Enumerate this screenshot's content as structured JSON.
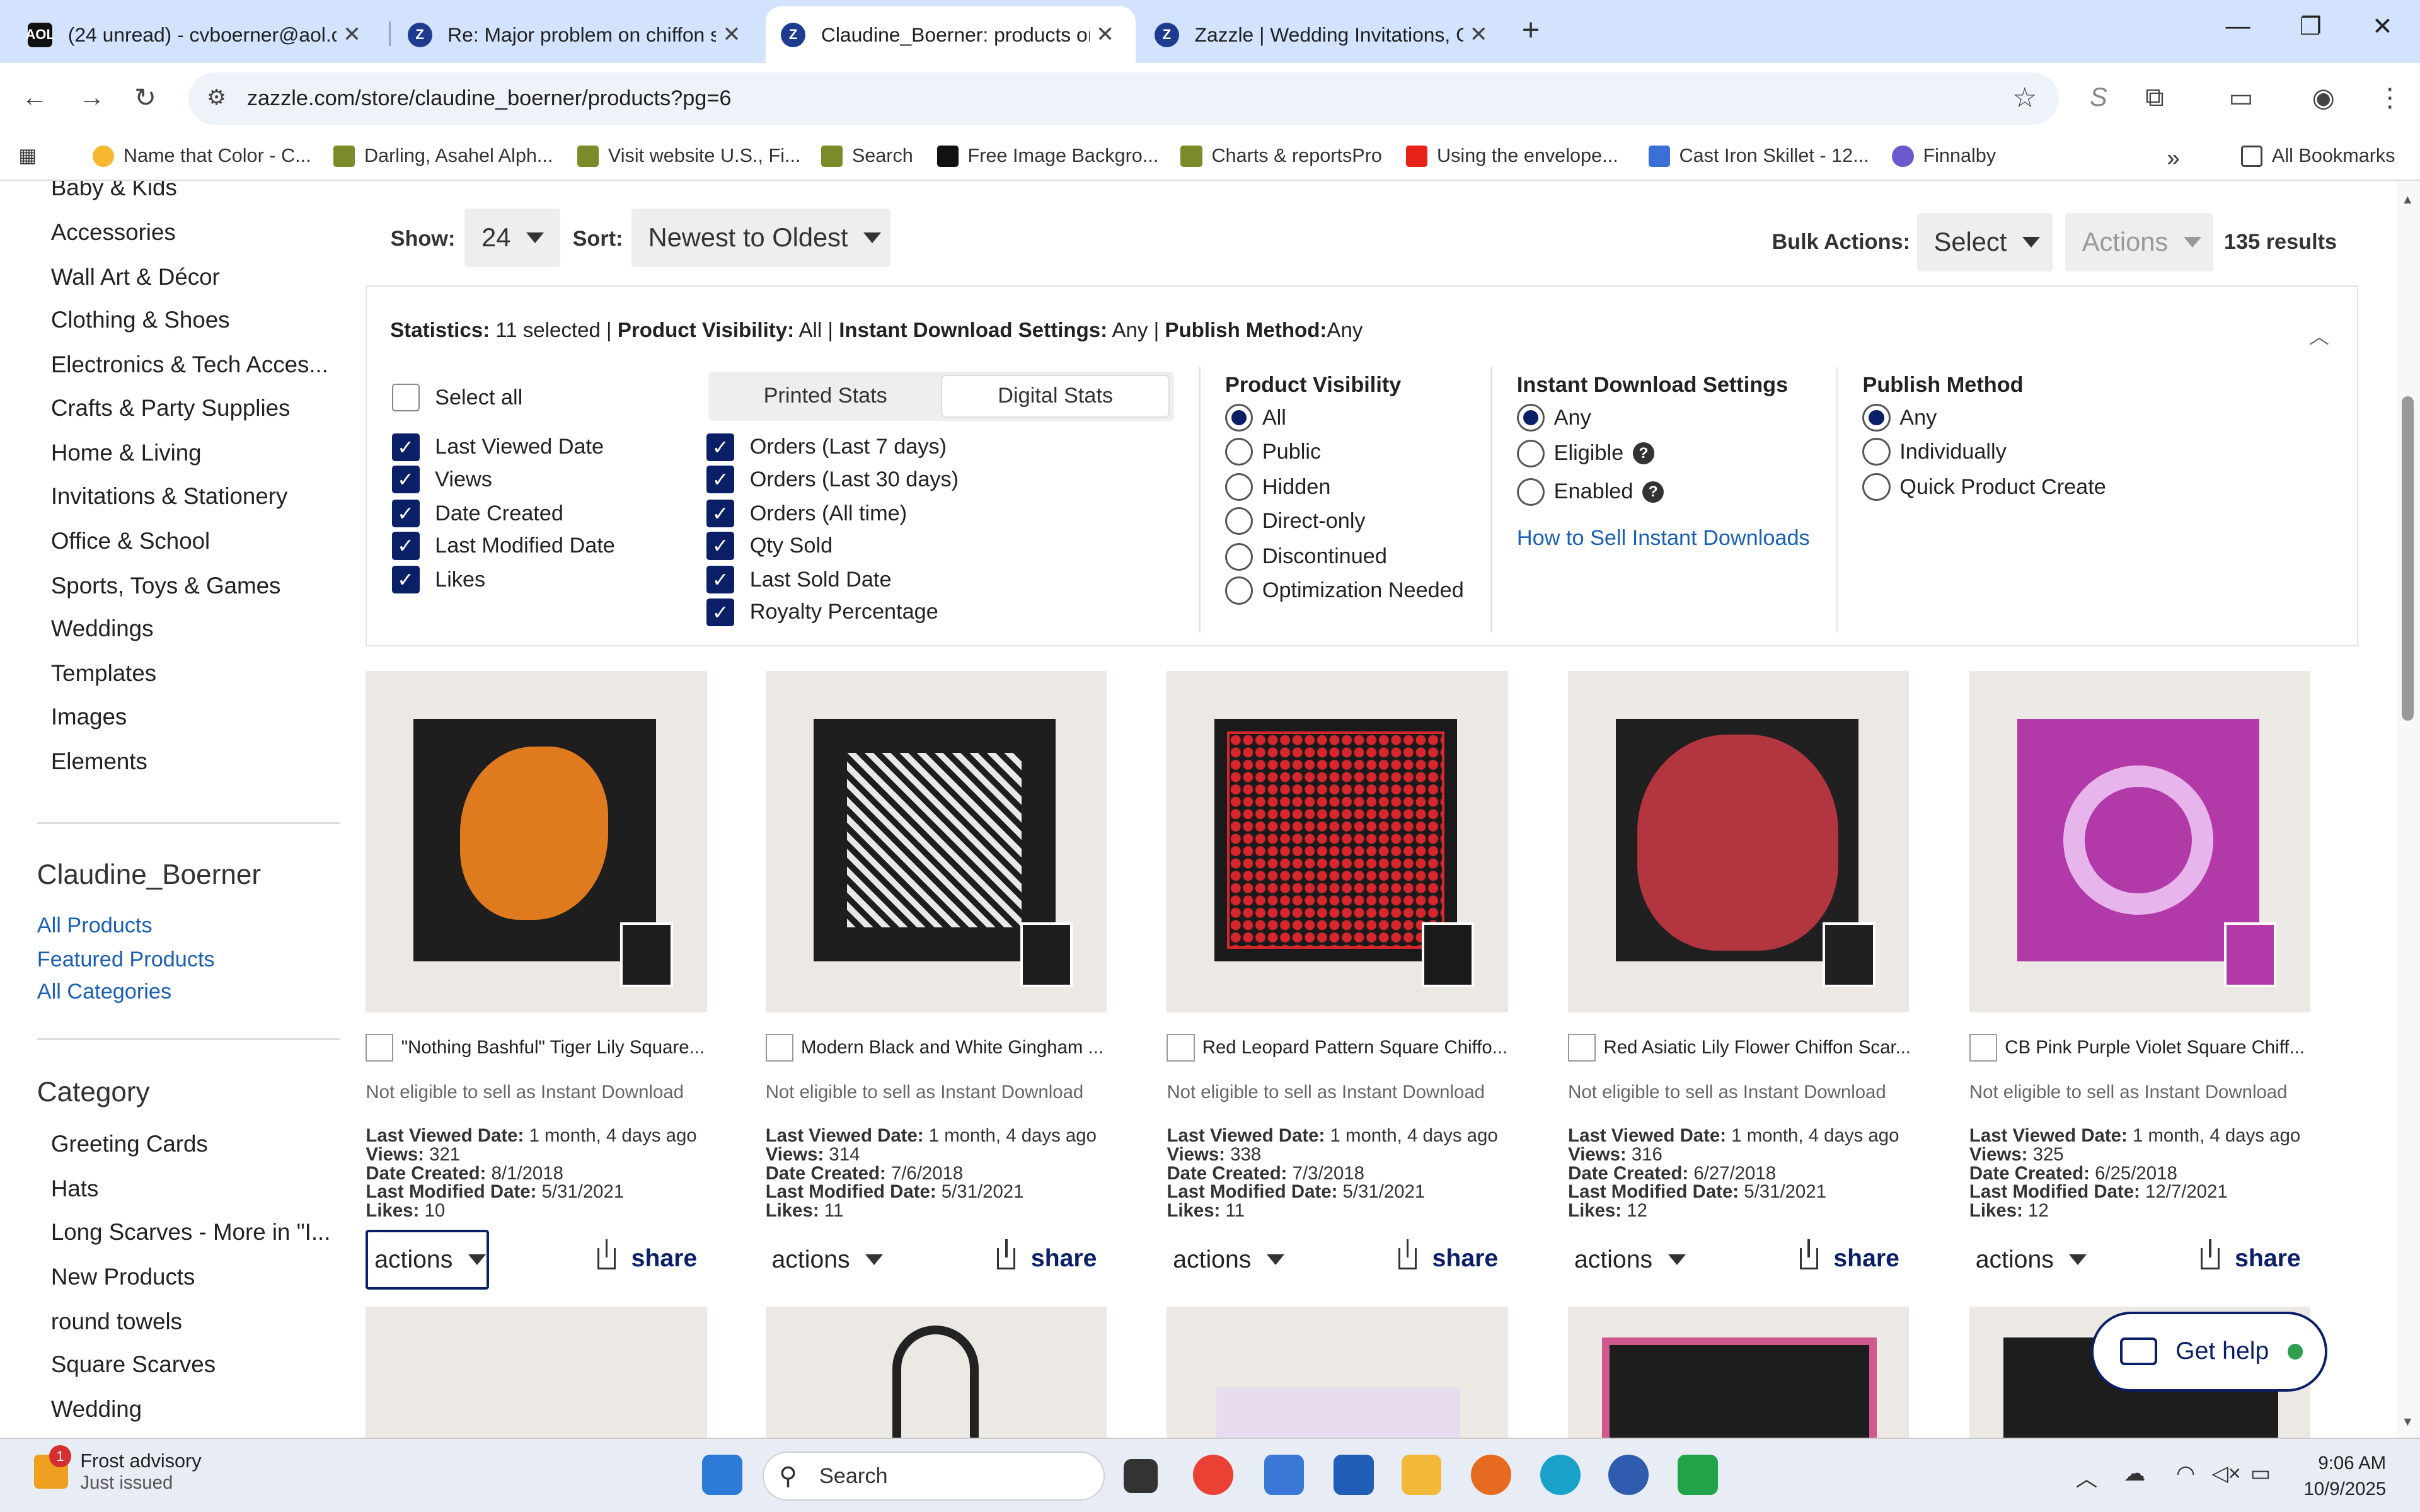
{
  "browser": {
    "tabs": [
      {
        "title": "(24 unread) - cvboerner@aol.co",
        "favicon_text": "AOL"
      },
      {
        "title": "Re: Major problem on chiffon sc",
        "favicon_text": "Z"
      },
      {
        "title": "Claudine_Boerner: products on",
        "favicon_text": "Z"
      },
      {
        "title": "Zazzle | Wedding Invitations, Ch",
        "favicon_text": "Z"
      }
    ],
    "url": "zazzle.com/store/claudine_boerner/products?pg=6",
    "bookmarks": [
      "Name that Color - C...",
      "Darling, Asahel Alph...",
      "Visit website U.S., Fi...",
      "Search",
      "Free Image Backgro...",
      "Charts & reportsPro",
      "Using the envelope...",
      "Cast Iron Skillet - 12...",
      "Finnalby"
    ],
    "all_bookmarks": "All Bookmarks"
  },
  "sidebar": {
    "top_links": [
      "Baby & Kids",
      "Accessories",
      "Wall Art & Décor",
      "Clothing & Shoes",
      "Electronics & Tech Acces...",
      "Crafts & Party Supplies",
      "Home & Living",
      "Invitations & Stationery",
      "Office & School",
      "Sports, Toys & Games",
      "Weddings",
      "Templates",
      "Images",
      "Elements"
    ],
    "store_name": "Claudine_Boerner",
    "store_links": [
      "All Products",
      "Featured Products",
      "All Categories"
    ],
    "category_heading": "Category",
    "categories": [
      "Greeting Cards",
      "Hats",
      "Long Scarves - More in \"I...",
      "New Products",
      "round towels",
      "Square Scarves",
      "Wedding"
    ]
  },
  "controls": {
    "show_label": "Show:",
    "show_value": "24",
    "sort_label": "Sort:",
    "sort_value": "Newest to Oldest",
    "bulk_label": "Bulk Actions:",
    "bulk_select": "Select",
    "bulk_actions": "Actions",
    "results": "135 results"
  },
  "stats": {
    "summary": {
      "stats_label": "Statistics:",
      "stats_value": "11 selected",
      "visibility_label": "Product Visibility:",
      "visibility_value": "All",
      "instant_label": "Instant Download Settings:",
      "instant_value": "Any",
      "publish_label": "Publish Method:",
      "publish_value": "Any"
    },
    "select_all": "Select all",
    "left_checks": [
      "Last Viewed Date",
      "Views",
      "Date Created",
      "Last Modified Date",
      "Likes"
    ],
    "tabs": [
      "Printed Stats",
      "Digital Stats"
    ],
    "active_tab": "Digital Stats",
    "mid_checks": [
      "Orders (Last 7 days)",
      "Orders (Last 30 days)",
      "Orders (All time)",
      "Qty Sold",
      "Last Sold Date",
      "Royalty Percentage"
    ],
    "visibility": {
      "title": "Product Visibility",
      "options": [
        "All",
        "Public",
        "Hidden",
        "Direct-only",
        "Discontinued",
        "Optimization Needed"
      ],
      "selected": "All"
    },
    "instant": {
      "title": "Instant Download Settings",
      "options": [
        "Any",
        "Eligible",
        "Enabled"
      ],
      "selected": "Any",
      "link": "How to Sell Instant Downloads"
    },
    "publish": {
      "title": "Publish Method",
      "options": [
        "Any",
        "Individually",
        "Quick Product Create"
      ],
      "selected": "Any"
    }
  },
  "products": [
    {
      "title": "\"Nothing Bashful\" Tiger Lily Square...",
      "eligibility": "Not eligible to sell as Instant Download",
      "last_viewed_label": "Last Viewed Date:",
      "last_viewed": "1 month, 4 days ago",
      "views_label": "Views:",
      "views": "321",
      "created_label": "Date Created:",
      "created": "8/1/2018",
      "modified_label": "Last Modified Date:",
      "modified": "5/31/2021",
      "likes_label": "Likes:",
      "likes": "10",
      "actions": "actions",
      "share": "share",
      "scarf_color": "#1e1e1e",
      "motif_color": "#e07a1f"
    },
    {
      "title": "Modern Black and White Gingham ...",
      "eligibility": "Not eligible to sell as Instant Download",
      "last_viewed_label": "Last Viewed Date:",
      "last_viewed": "1 month, 4 days ago",
      "views_label": "Views:",
      "views": "314",
      "created_label": "Date Created:",
      "created": "7/6/2018",
      "modified_label": "Last Modified Date:",
      "modified": "5/31/2021",
      "likes_label": "Likes:",
      "likes": "11",
      "actions": "actions",
      "share": "share",
      "scarf_color": "#1e1e1e",
      "motif_color": "#e8e8e8"
    },
    {
      "title": "Red Leopard Pattern Square Chiffo...",
      "eligibility": "Not eligible to sell as Instant Download",
      "last_viewed_label": "Last Viewed Date:",
      "last_viewed": "1 month, 4 days ago",
      "views_label": "Views:",
      "views": "338",
      "created_label": "Date Created:",
      "created": "7/3/2018",
      "modified_label": "Last Modified Date:",
      "modified": "5/31/2021",
      "likes_label": "Likes:",
      "likes": "11",
      "actions": "actions",
      "share": "share",
      "scarf_color": "#1a1a1a",
      "motif_color": "#d7262d"
    },
    {
      "title": "Red Asiatic Lily Flower Chiffon Scar...",
      "eligibility": "Not eligible to sell as Instant Download",
      "last_viewed_label": "Last Viewed Date:",
      "last_viewed": "1 month, 4 days ago",
      "views_label": "Views:",
      "views": "316",
      "created_label": "Date Created:",
      "created": "6/27/2018",
      "modified_label": "Last Modified Date:",
      "modified": "5/31/2021",
      "likes_label": "Likes:",
      "likes": "12",
      "actions": "actions",
      "share": "share",
      "scarf_color": "#202020",
      "motif_color": "#b3353f"
    },
    {
      "title": "CB Pink Purple Violet Square Chiff...",
      "eligibility": "Not eligible to sell as Instant Download",
      "last_viewed_label": "Last Viewed Date:",
      "last_viewed": "1 month, 4 days ago",
      "views_label": "Views:",
      "views": "325",
      "created_label": "Date Created:",
      "created": "6/25/2018",
      "modified_label": "Last Modified Date:",
      "modified": "12/7/2021",
      "likes_label": "Likes:",
      "likes": "12",
      "actions": "actions",
      "share": "share",
      "scarf_color": "#b23aa8",
      "motif_color": "#e8b4ec"
    }
  ],
  "get_help": "Get help",
  "taskbar": {
    "weather_title": "Frost advisory",
    "weather_sub": "Just issued",
    "weather_badge": "1",
    "search": "Search",
    "time": "9:06 AM",
    "date": "10/9/2025"
  }
}
